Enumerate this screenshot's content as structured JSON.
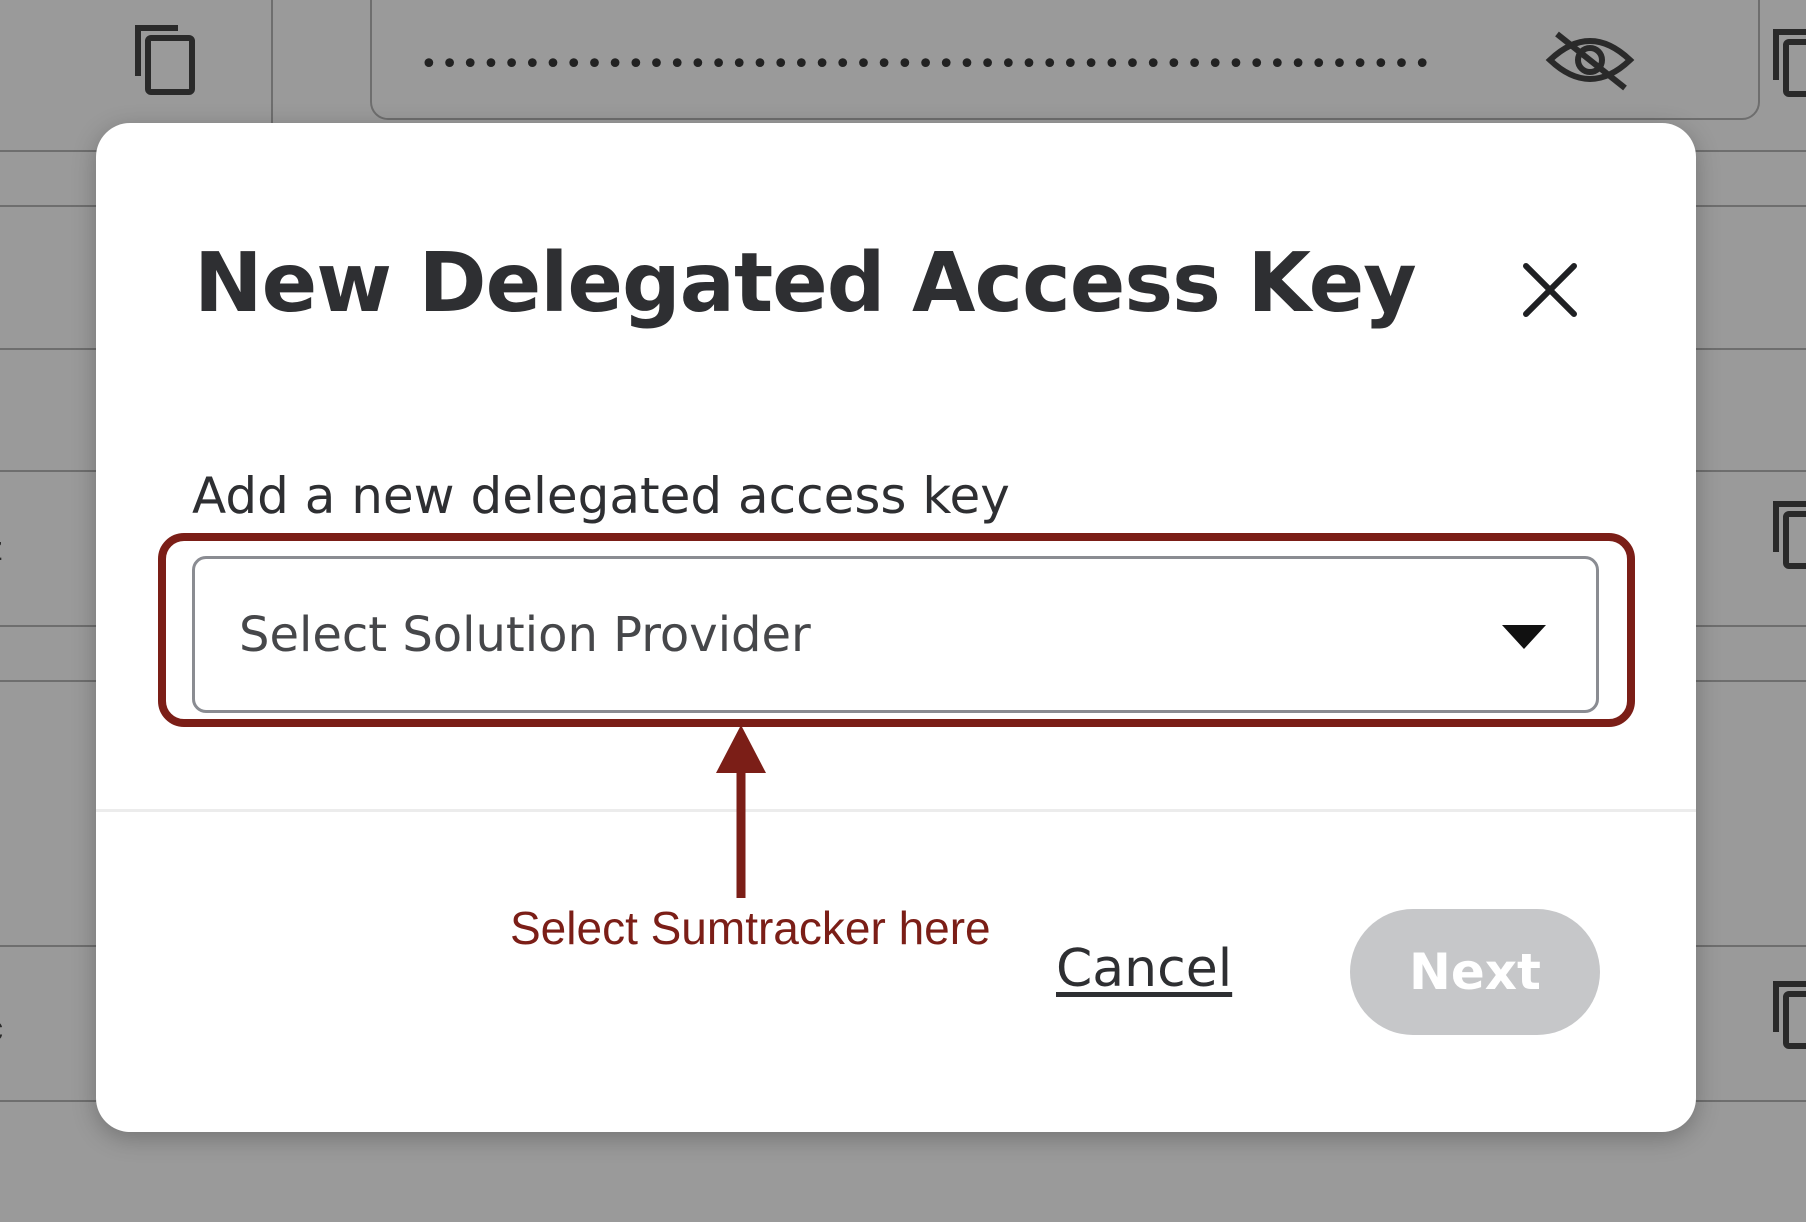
{
  "background": {
    "masked_value": "••••••••••••••••••••••••••••••••••••••••••••••••••••••••••••••••••••••••••••••••",
    "icons": [
      "copy-icon",
      "eye-slash-icon"
    ]
  },
  "modal": {
    "title": "New Delegated Access Key",
    "close_icon": "close-icon",
    "field_label": "Add a new delegated access key",
    "select": {
      "placeholder": "Select Solution Provider",
      "caret_icon": "caret-down-icon"
    },
    "cancel_label": "Cancel",
    "next_label": "Next",
    "next_disabled": true
  },
  "annotation": {
    "text": "Select Sumtracker here",
    "color": "#7b1e17"
  },
  "colors": {
    "overlay": "#9a9a9a",
    "title": "#2e2f32",
    "next_disabled_bg": "#c6c7c9"
  }
}
